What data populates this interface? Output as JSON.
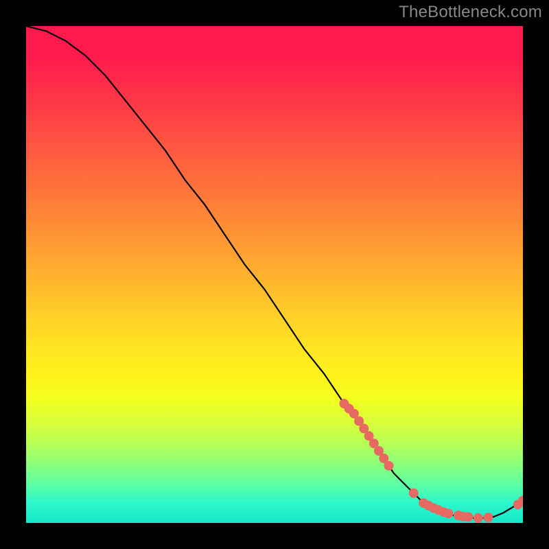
{
  "watermark": "TheBottleneck.com",
  "colors": {
    "page_bg": "#000000",
    "curve": "#000000",
    "dot": "#e66a62"
  },
  "chart_data": {
    "type": "line",
    "title": "",
    "xlabel": "",
    "ylabel": "",
    "xlim": [
      0,
      100
    ],
    "ylim": [
      0,
      100
    ],
    "grid": false,
    "legend": false,
    "series": [
      {
        "name": "bottleneck-curve",
        "x": [
          0,
          4,
          8,
          12,
          16,
          20,
          24,
          28,
          32,
          36,
          40,
          44,
          48,
          52,
          56,
          60,
          64,
          68,
          72,
          74,
          76,
          78,
          80,
          82,
          84,
          86,
          88,
          90,
          92,
          94,
          96,
          98,
          100
        ],
        "y": [
          100,
          99,
          97,
          94,
          90,
          85,
          80,
          75,
          69,
          64,
          58,
          52,
          47,
          41,
          35,
          30,
          24,
          19,
          13,
          10,
          8,
          6,
          4,
          3,
          2,
          1.5,
          1.2,
          1.0,
          1.0,
          1.2,
          2.0,
          3.2,
          4.5
        ]
      }
    ],
    "highlight_points": {
      "name": "marked-points",
      "x": [
        64,
        65,
        66,
        67,
        68,
        69,
        70,
        71,
        72,
        73,
        78,
        80,
        81,
        82,
        83,
        84,
        85,
        87,
        88,
        89,
        91,
        93,
        99,
        100
      ],
      "y": [
        24,
        23,
        22,
        20.5,
        19,
        17.5,
        16,
        14.5,
        13,
        11.5,
        6,
        4,
        3.5,
        3,
        2.6,
        2.2,
        1.9,
        1.5,
        1.3,
        1.2,
        1.0,
        1.1,
        3.7,
        4.5
      ]
    }
  }
}
